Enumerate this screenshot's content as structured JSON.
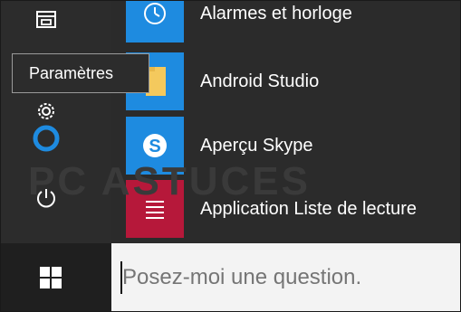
{
  "tooltip": {
    "text": "Paramètres"
  },
  "apps": [
    {
      "label": "Alarmes et horloge",
      "icon": "clock-icon",
      "tile_color": "#1e8be0"
    },
    {
      "label": "Android Studio",
      "icon": "folder-icon",
      "tile_color": "#1e8be0"
    },
    {
      "label": "Aperçu Skype",
      "icon": "skype-icon",
      "tile_color": "#1e8be0"
    },
    {
      "label": "Application Liste de lecture",
      "icon": "reading-list-icon",
      "tile_color": "#b6183a"
    }
  ],
  "rail": [
    "file-explorer-icon",
    "gear-icon",
    "power-icon"
  ],
  "search": {
    "placeholder": "Posez-moi une question."
  },
  "watermark": "PC ASTUCES"
}
